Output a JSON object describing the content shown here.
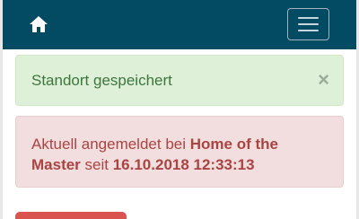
{
  "navbar": {
    "bg_color": "#034a63",
    "home_icon": "home-icon",
    "menu_icon": "hamburger-menu-icon"
  },
  "alerts": {
    "success": {
      "message": "Standort gespeichert",
      "close_label": "×",
      "color": "#3c763d",
      "bg_color": "#dff0d8"
    },
    "info": {
      "prefix": "Aktuell angemeldet bei ",
      "location": "Home of the Master",
      "middle": " seit ",
      "datetime": "16.10.2018 12:33:13",
      "color": "#a94442",
      "bg_color": "#f2dede"
    }
  },
  "action_button": {
    "color": "#d9534f"
  }
}
